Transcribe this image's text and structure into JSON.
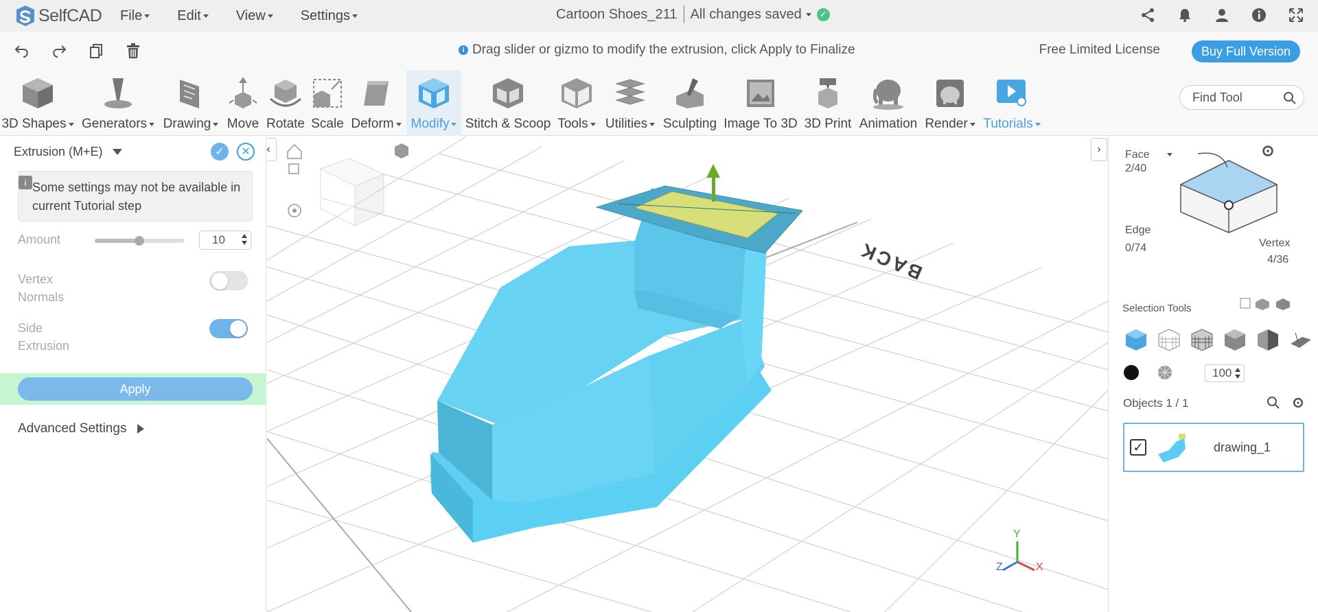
{
  "app": {
    "logo_text": "SelfCAD",
    "menu": [
      "File",
      "Edit",
      "View",
      "Settings"
    ],
    "doc_title": "Cartoon Shoes_211",
    "save_status": "All changes saved"
  },
  "topbar_icons": [
    "share-icon",
    "bell-icon",
    "user-icon",
    "info-icon",
    "fullscreen-icon"
  ],
  "secondary_bar": {
    "tools": [
      "undo-icon",
      "redo-icon",
      "copy-icon",
      "trash-icon"
    ],
    "hint": "Drag slider or gizmo to modify the extrusion, click Apply to Finalize",
    "license": "Free Limited License",
    "buy_label": "Buy Full Version"
  },
  "toolbar": {
    "items": [
      {
        "label": "3D Shapes",
        "dropdown": true
      },
      {
        "label": "Generators",
        "dropdown": true
      },
      {
        "label": "Drawing",
        "dropdown": true
      },
      {
        "label": "Move",
        "dropdown": false
      },
      {
        "label": "Rotate",
        "dropdown": false
      },
      {
        "label": "Scale",
        "dropdown": false
      },
      {
        "label": "Deform",
        "dropdown": true
      },
      {
        "label": "Modify",
        "dropdown": true,
        "active": true
      },
      {
        "label": "Stitch & Scoop",
        "dropdown": false
      },
      {
        "label": "Tools",
        "dropdown": true
      },
      {
        "label": "Utilities",
        "dropdown": true
      },
      {
        "label": "Sculpting",
        "dropdown": false
      },
      {
        "label": "Image To 3D",
        "dropdown": false
      },
      {
        "label": "3D Print",
        "dropdown": false
      },
      {
        "label": "Animation",
        "dropdown": false
      },
      {
        "label": "Render",
        "dropdown": true
      },
      {
        "label": "Tutorials",
        "dropdown": true,
        "blue": true
      }
    ],
    "find_placeholder": "Find Tool"
  },
  "left_panel": {
    "title": "Extrusion (M+E)",
    "notice": "Some settings may not be available in current Tutorial step",
    "amount_label": "Amount",
    "amount_value": "10",
    "amount_slider_fraction": 0.5,
    "vertex_normals_label": "Vertex Normals",
    "vertex_normals_on": false,
    "side_extrusion_label": "Side Extrusion",
    "side_extrusion_on": true,
    "apply_label": "Apply",
    "advanced_label": "Advanced Settings"
  },
  "viewport": {
    "back_label": "BACK",
    "axes": {
      "x": "X",
      "y": "Y",
      "z": "Z"
    },
    "colors": {
      "model": "#68d2f2",
      "selected_face": "#d8df78",
      "gizmo_arrow": "#6aab2e"
    }
  },
  "right_panel": {
    "face_label": "Face",
    "face_count": "2/40",
    "edge_label": "Edge",
    "edge_count": "0/74",
    "vertex_label": "Vertex",
    "vertex_count": "4/36",
    "selection_tools_label": "Selection Tools",
    "opacity_value": "100",
    "objects_label": "Objects 1 / 1",
    "object_name": "drawing_1"
  },
  "colors": {
    "accent": "#3a9ee4",
    "apply_row": "#c6f5d2"
  }
}
